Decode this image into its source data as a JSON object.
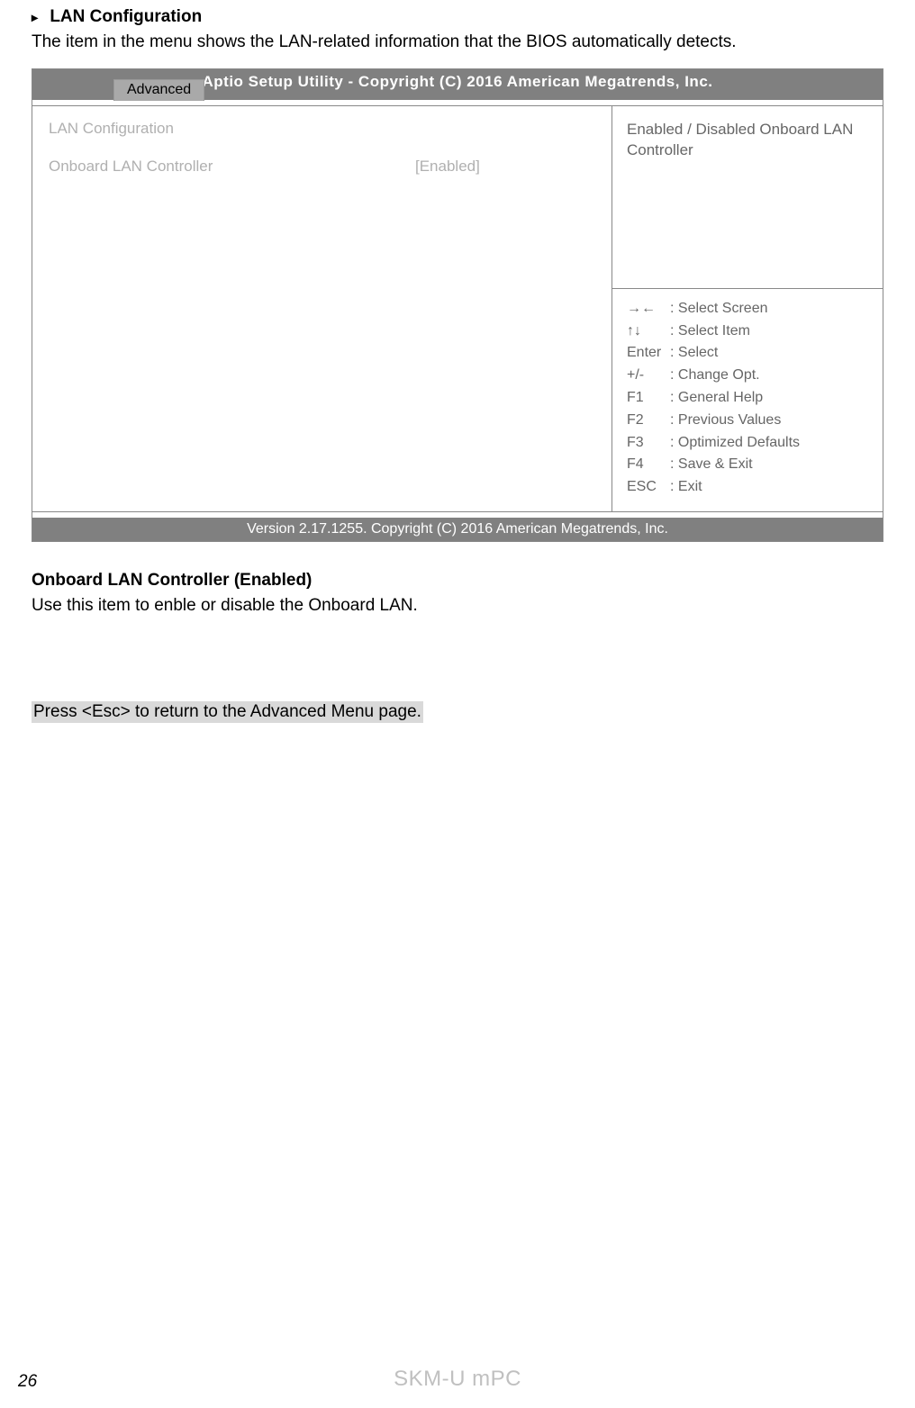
{
  "section": {
    "heading": "LAN Configuration",
    "intro": "The item in the menu shows the LAN-related information that the BIOS automatically detects."
  },
  "bios": {
    "title": "Aptio Setup Utility - Copyright (C) 2016 American Megatrends, Inc.",
    "tab": "Advanced",
    "left": {
      "section_title": "LAN Configuration",
      "setting_label": "Onboard LAN Controller",
      "setting_value": "[Enabled]"
    },
    "right": {
      "description": "Enabled / Disabled Onboard LAN Controller",
      "help": [
        {
          "key": "→←",
          "desc": ": Select Screen"
        },
        {
          "key": "↑↓",
          "desc": ": Select Item"
        },
        {
          "key": "Enter",
          "desc": ": Select"
        },
        {
          "key": "+/-",
          "desc": ": Change Opt."
        },
        {
          "key": "F1",
          "desc": ": General Help"
        },
        {
          "key": "F2",
          "desc": ": Previous Values"
        },
        {
          "key": "F3",
          "desc": ": Optimized Defaults"
        },
        {
          "key": "F4",
          "desc": ": Save & Exit"
        },
        {
          "key": "ESC",
          "desc": ": Exit"
        }
      ]
    },
    "footer": "Version 2.17.1255. Copyright (C) 2016 American Megatrends, Inc."
  },
  "description": {
    "heading": "Onboard LAN Controller (Enabled)",
    "text": "Use this item to enble or disable the Onboard LAN."
  },
  "note": "Press <Esc> to return to the Advanced Menu page.",
  "page_number": "26",
  "brand": "SKM-U mPC"
}
